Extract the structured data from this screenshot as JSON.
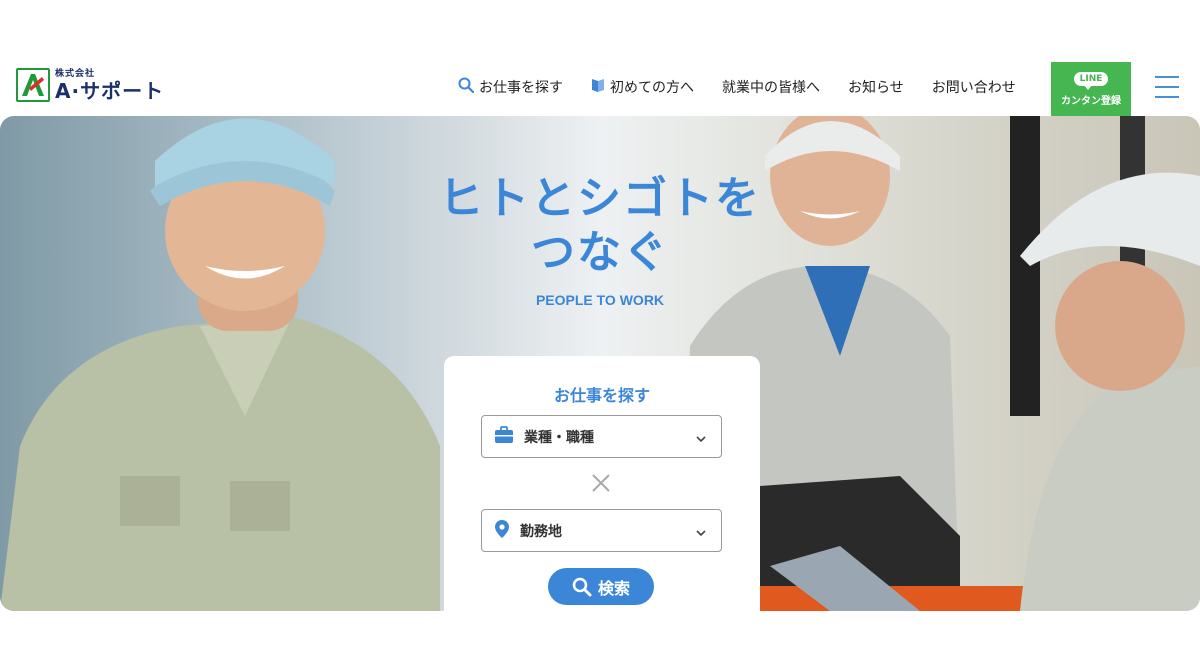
{
  "brand": {
    "company_type": "株式会社",
    "name": "A·サポート",
    "logo_colors": {
      "green": "#1f9a3a",
      "red": "#d8302a",
      "navy": "#1b2f6b"
    }
  },
  "nav": {
    "items": [
      {
        "label": "お仕事を探す",
        "icon": "search-icon"
      },
      {
        "label": "初めての方へ",
        "icon": "book-icon"
      },
      {
        "label": "就業中の皆様へ"
      },
      {
        "label": "お知らせ"
      },
      {
        "label": "お問い合わせ"
      }
    ],
    "line_button": {
      "badge": "LINE",
      "label": "カンタン登録",
      "color": "#45b650"
    },
    "menu_icon": "hamburger-menu-icon"
  },
  "hero": {
    "title_line1": "ヒトとシゴトを",
    "title_line2": "つなぐ",
    "subtitle": "PEOPLE TO WORK",
    "accent_color": "#3c86d8"
  },
  "search": {
    "title": "お仕事を探す",
    "industry_select": {
      "label": "業種・職種",
      "icon": "briefcase-icon"
    },
    "separator_icon": "cross-icon",
    "location_select": {
      "label": "勤務地",
      "icon": "map-pin-icon"
    },
    "submit_label": "検索"
  }
}
